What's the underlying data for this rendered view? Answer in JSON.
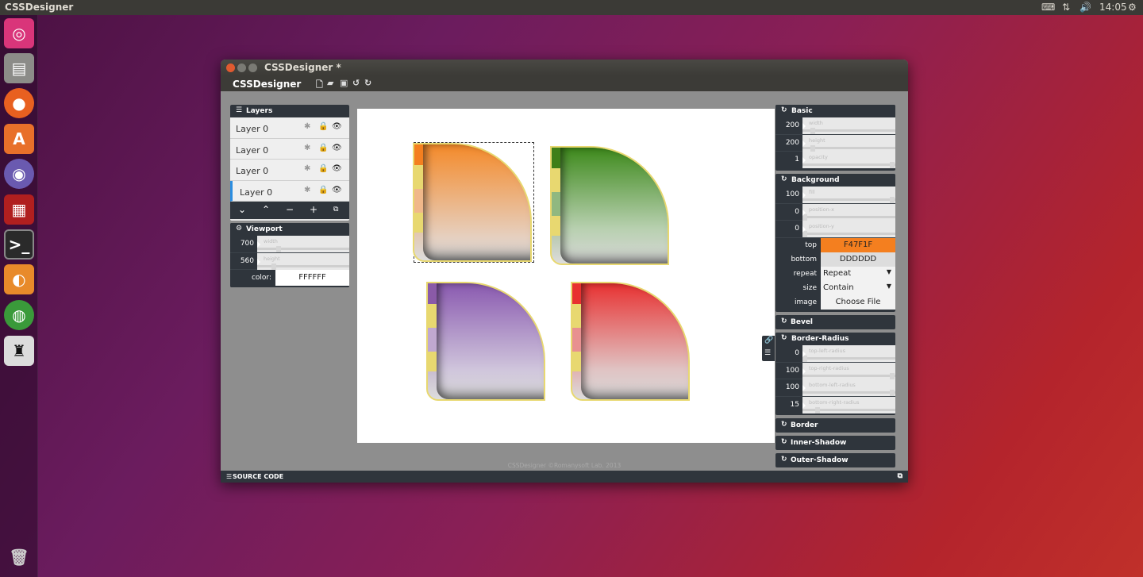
{
  "topbar": {
    "app_title": "CSSDesigner",
    "clock": "14:05"
  },
  "launcher": {
    "items": [
      "ubuntu-icon",
      "files-icon",
      "firefox-icon",
      "software-center-icon",
      "pidgin-icon",
      "workspace-icon",
      "terminal-icon",
      "shotwell-icon",
      "chrome-icon",
      "cssdesigner-icon",
      "trash-icon"
    ]
  },
  "window": {
    "title": "CSSDesigner *",
    "app_name": "CSSDesigner"
  },
  "layers": {
    "header": "Layers",
    "items": [
      {
        "label": "Layer 0"
      },
      {
        "label": "Layer 0"
      },
      {
        "label": "Layer 0"
      },
      {
        "label": "Layer 0"
      }
    ]
  },
  "viewport": {
    "header": "Viewport",
    "width": {
      "value": "700",
      "label": "width"
    },
    "height": {
      "value": "560",
      "label": "height"
    },
    "color_label": "color:",
    "color_value": "FFFFFF"
  },
  "basic": {
    "header": "Basic",
    "width": {
      "value": "200",
      "label": "width"
    },
    "height": {
      "value": "200",
      "label": "height"
    },
    "opacity": {
      "value": "1",
      "label": "opacity"
    }
  },
  "background": {
    "header": "Background",
    "fill": {
      "value": "100",
      "label": "fill"
    },
    "position_x": {
      "value": "0",
      "label": "position-x"
    },
    "position_y": {
      "value": "0",
      "label": "position-y"
    },
    "top_label": "top",
    "top_value": "F47F1F",
    "bottom_label": "bottom",
    "bottom_value": "DDDDDD",
    "repeat_label": "repeat",
    "repeat_value": "Repeat",
    "size_label": "size",
    "size_value": "Contain",
    "image_label": "image",
    "image_button": "Choose File"
  },
  "bevel": {
    "header": "Bevel"
  },
  "border_radius": {
    "header": "Border-Radius",
    "top_left": {
      "value": "0",
      "label": "top-left-radius"
    },
    "top_right": {
      "value": "100",
      "label": "top-right-radius"
    },
    "bottom_left": {
      "value": "100",
      "label": "bottom-left-radius"
    },
    "bottom_right": {
      "value": "15",
      "label": "bottom-right-radius"
    }
  },
  "border": {
    "header": "Border"
  },
  "inner_shadow": {
    "header": "Inner-Shadow"
  },
  "outer_shadow": {
    "header": "Outer-Shadow"
  },
  "footer": {
    "source_code": "SOURCE CODE",
    "copyright": "CSSDesigner ©Romanysoft Lab. 2013"
  },
  "colors": {
    "orange": "#F47F1F",
    "green": "#4a8a20",
    "purple": "#8a5aa8",
    "red": "#e83030",
    "panel_dark": "#2f353c"
  }
}
